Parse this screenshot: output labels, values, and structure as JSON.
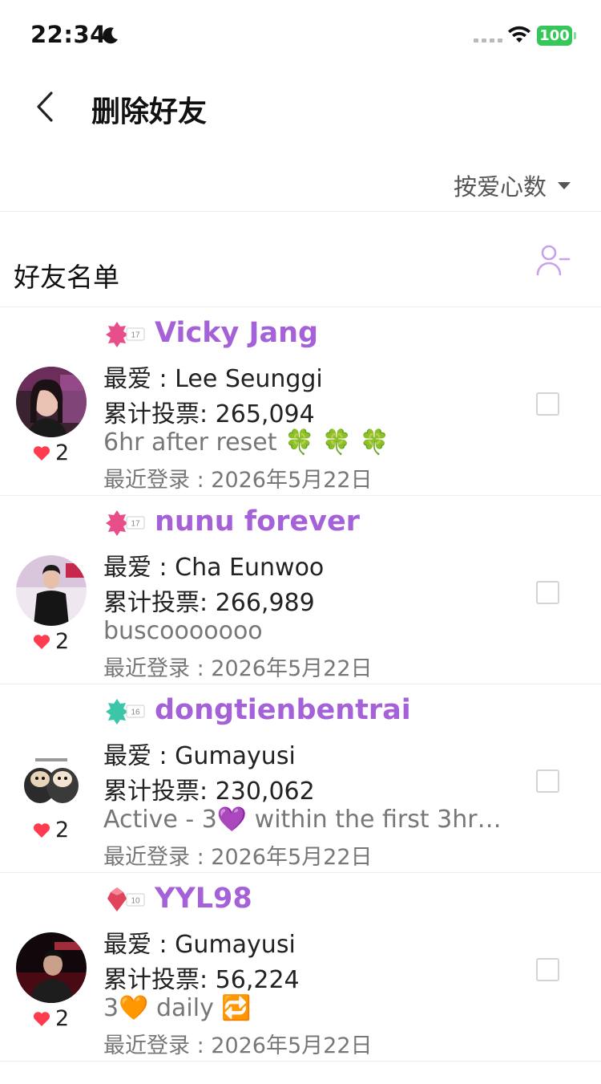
{
  "status_bar": {
    "time": "22:34",
    "battery": "100"
  },
  "nav": {
    "title": "删除好友"
  },
  "sort": {
    "label": "按爱心数"
  },
  "section": {
    "title": "好友名单"
  },
  "colors": {
    "accent": "#a562d8",
    "battery": "#34c759",
    "heart": "#ff3b4f"
  },
  "friends": [
    {
      "badge_level": "17",
      "badge_color": "#e84f8a",
      "name": "Vicky Jang",
      "fav": "最爱 : Lee Seunggi",
      "votes": "累计投票: 265,094",
      "status": "6hr after reset 🍀 🍀 🍀",
      "last_login": "最近登录 : 2026年5月22日",
      "hearts": "2"
    },
    {
      "badge_level": "17",
      "badge_color": "#e84f8a",
      "name": "nunu forever",
      "fav": "最爱 : Cha Eunwoo",
      "votes": "累计投票: 266,989",
      "status": "buscooooooo",
      "last_login": "最近登录 : 2026年5月22日",
      "hearts": "2"
    },
    {
      "badge_level": "16",
      "badge_color": "#3cc6a8",
      "name": "dongtienbentrai",
      "fav": "最爱 : Gumayusi",
      "votes": "累计投票: 230,062",
      "status": "Active - 3💜 within the first 3hrs...",
      "last_login": "最近登录 : 2026年5月22日",
      "hearts": "2"
    },
    {
      "badge_level": "10",
      "badge_color": "#e0445c",
      "name": "YYL98",
      "fav": "最爱 : Gumayusi",
      "votes": "累计投票: 56,224",
      "status": "3🧡 daily 🔁",
      "last_login": "最近登录 : 2026年5月22日",
      "hearts": "2"
    }
  ]
}
